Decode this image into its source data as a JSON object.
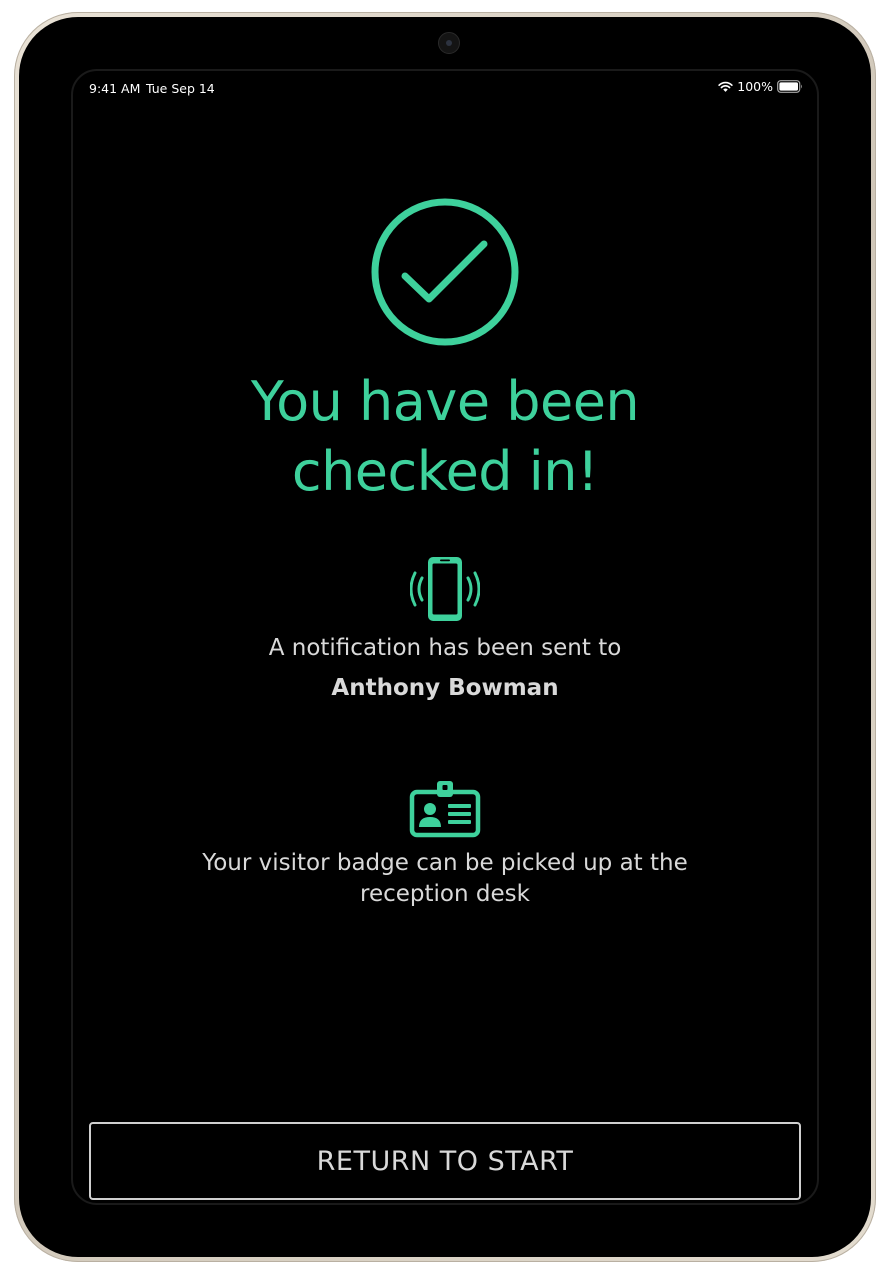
{
  "status_bar": {
    "time": "9:41 AM",
    "date": "Tue Sep 14",
    "battery": "100%"
  },
  "icons": {
    "success": "check-circle-icon",
    "notification": "vibrating-phone-icon",
    "badge": "id-badge-icon",
    "wifi": "wifi-icon",
    "battery": "battery-icon"
  },
  "colors": {
    "accent": "#3ed19c",
    "text": "#d9d9d9",
    "background": "#000000"
  },
  "confirmation": {
    "headline_line1": "You have been",
    "headline_line2": "checked in!"
  },
  "notification": {
    "message": "A notification has been sent to",
    "host_name": "Anthony Bowman"
  },
  "badge": {
    "message_line1": "Your visitor badge can be picked up at the",
    "message_line2": "reception desk"
  },
  "actions": {
    "return_label": "RETURN TO START"
  }
}
